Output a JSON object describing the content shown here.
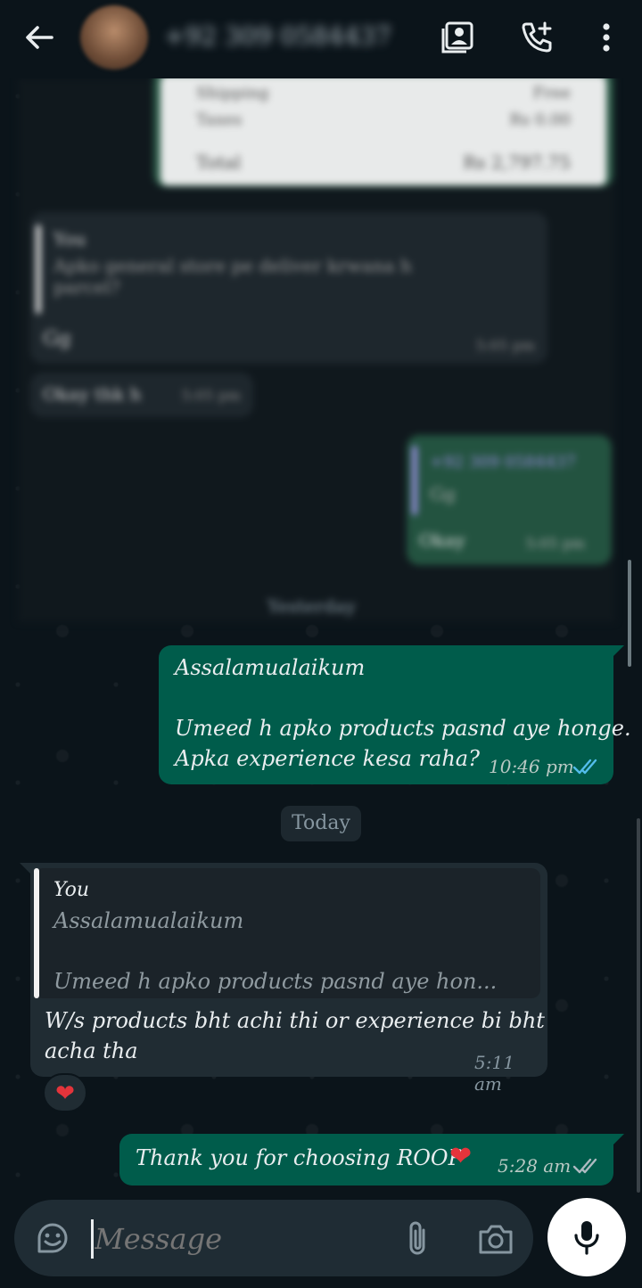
{
  "header": {
    "contact_name": "+92 309 0584437"
  },
  "blurred": {
    "order_rows": [
      {
        "label": "Shipping",
        "value": "Free"
      },
      {
        "label": "Taxes",
        "value": "Rs 0.00"
      },
      {
        "label": "Total",
        "value": "Rs 2,797.75"
      }
    ],
    "quote_author": "You",
    "quote_text": "Apko general store pe deliver krwana h parcel?",
    "reply1": "Gg",
    "reply1_time": "5:05 pm",
    "reply2": "Okay thk h",
    "reply2_time": "5:05 pm",
    "out_quote_author": "+92 309 0584437",
    "out_quote_text": "Gg",
    "out_reply": "Okay",
    "out_reply_time": "5:05 pm",
    "date_yesterday": "Yesterday"
  },
  "messages": {
    "m1_line1": "Assalamualaikum",
    "m1_line2": "Umeed h apko products pasnd aye honge.",
    "m1_line3": "Apka experience kesa raha?",
    "m1_time": "10:46 pm",
    "date_today": "Today",
    "m2_quote_author": "You",
    "m2_quote_line1": "Assalamualaikum",
    "m2_quote_line2": "Umeed h apko products pasnd aye hon...",
    "m2_line1": "W/s products bht achi thi or experience bi bht",
    "m2_line2": "acha tha",
    "m2_time": "5:11 am",
    "m2_reaction": "❤",
    "m3_text": "Thank you for choosing ROOP",
    "m3_emoji": "❤",
    "m3_time": "5:28 am"
  },
  "composer": {
    "placeholder": "Message"
  },
  "icons": {
    "back": "arrow-left-icon",
    "video": "video-call-icon",
    "call": "add-call-icon",
    "menu": "more-vert-icon",
    "sticker": "sticker-icon",
    "attach": "paperclip-icon",
    "camera": "camera-icon",
    "mic": "mic-icon",
    "read": "double-check-icon"
  },
  "colors": {
    "bg": "#0b141a",
    "incoming": "#202c33",
    "outgoing": "#005c4b",
    "read_tick": "#53bdeb"
  }
}
